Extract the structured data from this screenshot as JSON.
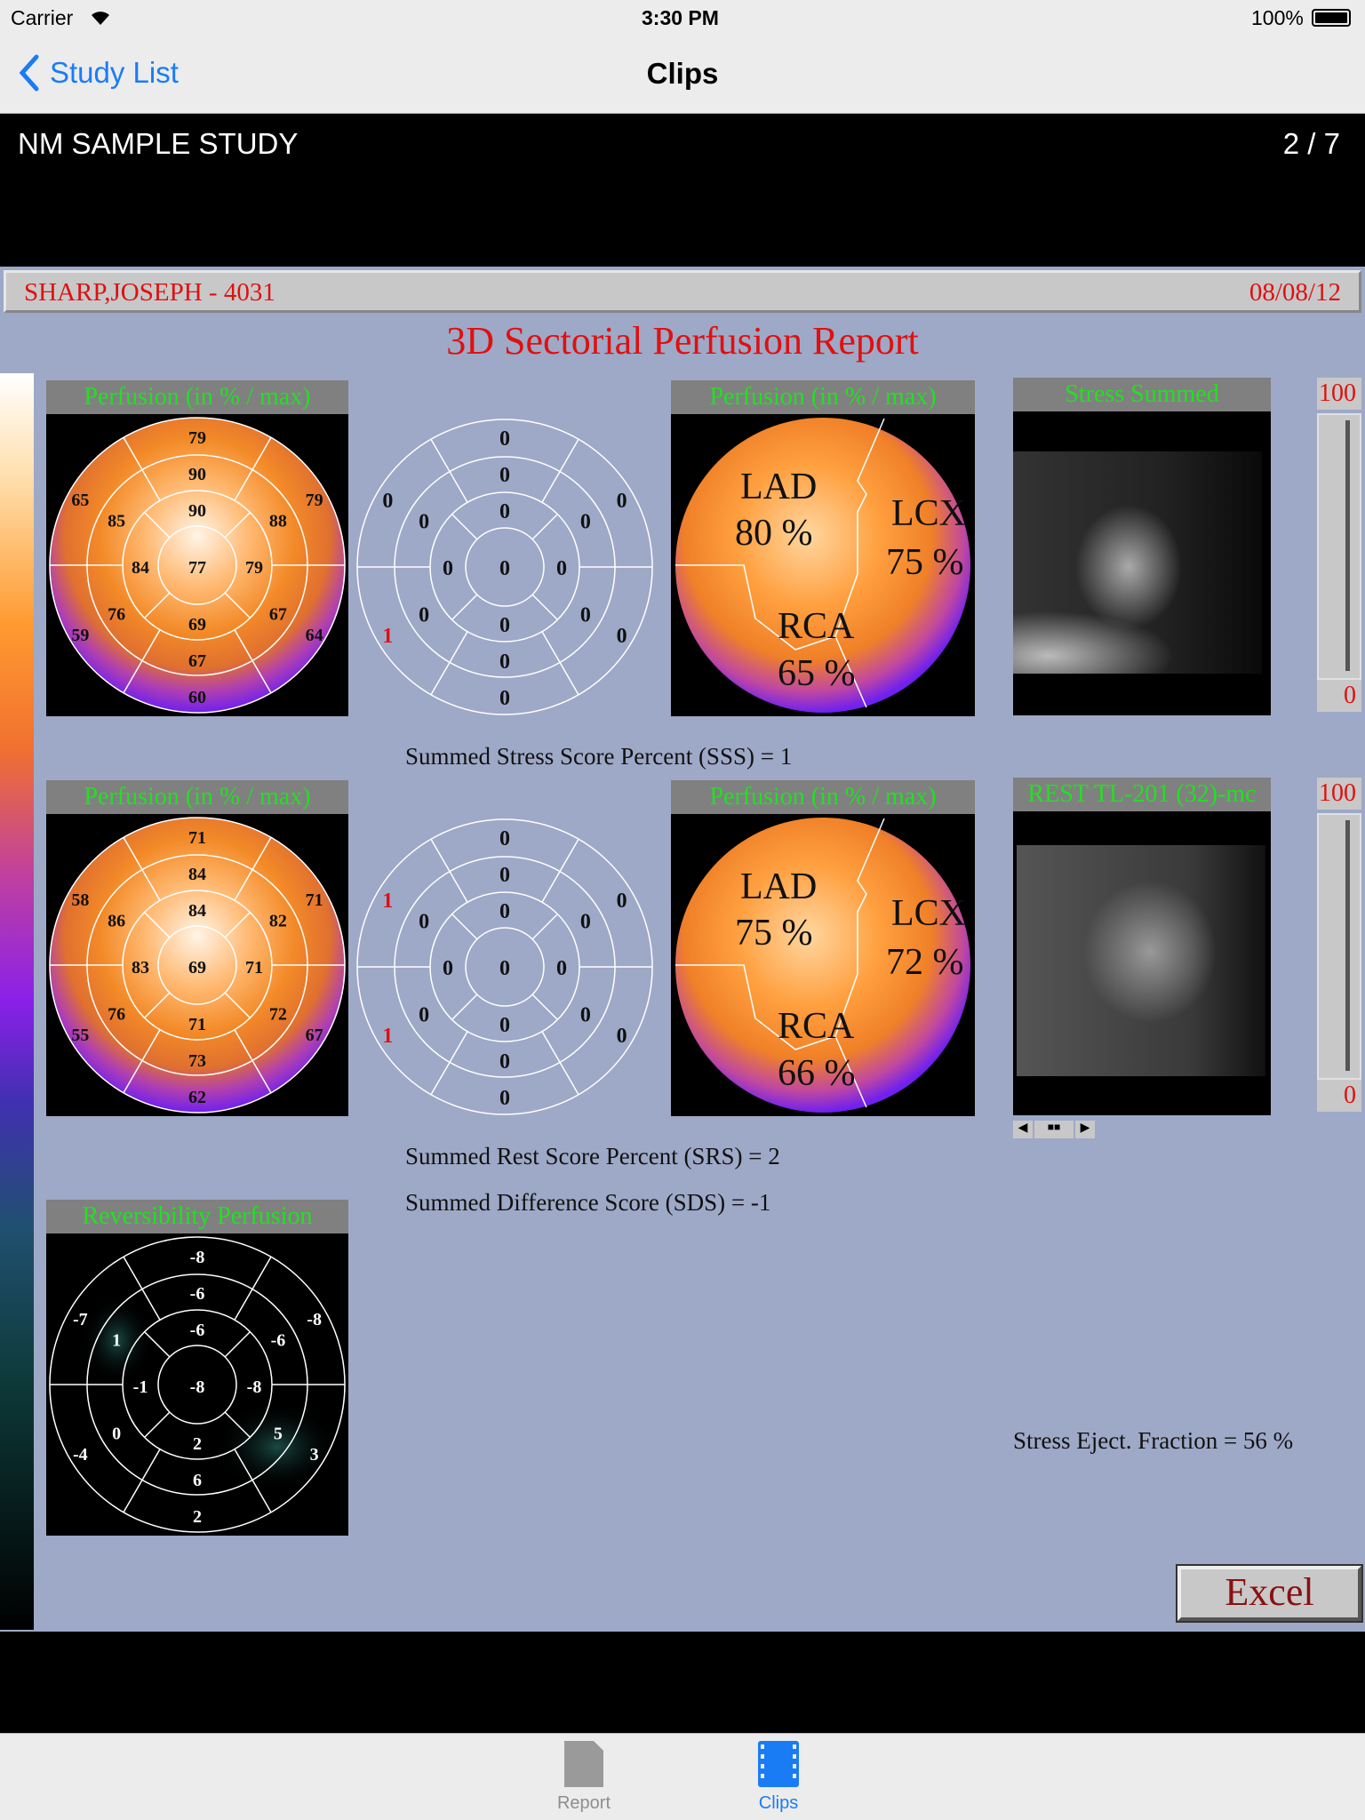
{
  "status_bar": {
    "carrier": "Carrier",
    "time": "3:30 PM",
    "battery": "100%"
  },
  "nav": {
    "back_label": "Study List",
    "title": "Clips"
  },
  "study": {
    "name": "NM SAMPLE STUDY",
    "position": "2 / 7"
  },
  "report": {
    "patient": "SHARP,JOSEPH - 4031",
    "date": "08/08/12",
    "title": "3D Sectorial Perfusion Report",
    "stress_polar": {
      "header": "Perfusion (in % / max)",
      "outer": [
        79,
        79,
        64,
        60,
        59,
        65
      ],
      "mid": [
        90,
        88,
        67,
        67,
        76,
        85
      ],
      "inner": [
        90,
        79,
        69,
        84
      ],
      "apex": 77
    },
    "stress_score": {
      "outer": [
        0,
        0,
        0,
        0,
        1,
        0
      ],
      "mid": [
        0,
        0,
        0,
        0,
        0,
        0
      ],
      "inner": [
        0,
        0,
        0,
        0
      ],
      "apex": 0
    },
    "stress_territory": {
      "header": "Perfusion (in % / max)",
      "lad": "LAD",
      "lad_pct": "80 %",
      "lcx": "LCX",
      "lcx_pct": "75 %",
      "rca": "RCA",
      "rca_pct": "65 %"
    },
    "stress_image": {
      "header": "Stress Summed",
      "max": "100",
      "min": "0"
    },
    "sss": "Summed Stress Score Percent (SSS) = 1",
    "rest_polar": {
      "header": "Perfusion (in % / max)",
      "outer": [
        71,
        71,
        67,
        62,
        55,
        58
      ],
      "mid": [
        84,
        82,
        72,
        73,
        76,
        86
      ],
      "inner": [
        84,
        71,
        71,
        83
      ],
      "apex": 69
    },
    "rest_score": {
      "outer": [
        0,
        0,
        0,
        0,
        1,
        1
      ],
      "mid": [
        0,
        0,
        0,
        0,
        0,
        0
      ],
      "inner": [
        0,
        0,
        0,
        0
      ],
      "apex": 0
    },
    "rest_territory": {
      "header": "Perfusion (in % / max)",
      "lad": "LAD",
      "lad_pct": "75 %",
      "lcx": "LCX",
      "lcx_pct": "72 %",
      "rca": "RCA",
      "rca_pct": "66 %"
    },
    "rest_image": {
      "header": "REST TL-201 (32)-mc",
      "max": "100",
      "min": "0"
    },
    "srs": "Summed Rest Score Percent (SRS) = 2",
    "sds": "Summed Difference Score (SDS) = -1",
    "reversibility": {
      "header": "Reversibility Perfusion",
      "outer": [
        -8,
        -8,
        3,
        2,
        -4,
        -7
      ],
      "mid": [
        -6,
        -6,
        5,
        6,
        0,
        1
      ],
      "inner": [
        -6,
        -8,
        2,
        -1
      ],
      "apex": -8
    },
    "ef": "Stress Eject. Fraction = 56 %",
    "excel_label": "Excel",
    "colors": {
      "background": "#9ea9c7",
      "header_text": "#22e022",
      "patient_text": "#e01010"
    }
  },
  "tabs": [
    {
      "label": "Report",
      "icon": "document-icon",
      "active": false
    },
    {
      "label": "Clips",
      "icon": "film-icon",
      "active": true
    }
  ],
  "colors": {
    "ios_blue": "#1a7cf5"
  }
}
